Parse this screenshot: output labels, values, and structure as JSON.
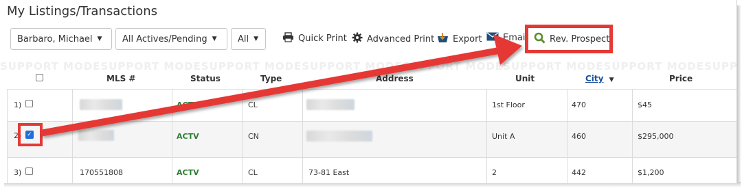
{
  "page": {
    "title": "My Listings/Transactions"
  },
  "filters": {
    "agent": "Barbaro, Michael",
    "status_filter": "All Actives/Pending",
    "scope": "All"
  },
  "toolbar": {
    "quick_print": "Quick Print",
    "advanced_print": "Advanced Print",
    "export": "Export",
    "email": "Email",
    "rev_prospect": "Rev. Prospect"
  },
  "watermark": "SUPPORT MODESUPPORT MODESUPPORT MODESUPPORT MODESUPPORT MODESUPPORT MODESUPPORT MODESUPPORT MODESUPPORT MODESUPPORT MODESUPPORT MODE",
  "table": {
    "headers": {
      "mls": "MLS #",
      "status": "Status",
      "type": "Type",
      "address": "Address",
      "unit": "Unit",
      "city": "City",
      "price": "Price"
    },
    "rows": [
      {
        "num": "1)",
        "checked": false,
        "status": "ACTV",
        "type": "CL",
        "unit": "1st Floor",
        "city": "470",
        "price": "$45"
      },
      {
        "num": "2)",
        "checked": true,
        "status": "ACTV",
        "type": "CN",
        "unit": "Unit A",
        "city": "460",
        "price": "$295,000"
      },
      {
        "num": "3)",
        "checked": false,
        "mls": "170551808",
        "status": "ACTV",
        "type": "CL",
        "address": "73-81 East",
        "unit": "2",
        "city": "442",
        "price": "$1,200"
      }
    ]
  },
  "colors": {
    "accent_red": "#e53935",
    "status_green": "#2e7d32",
    "link_blue": "#1a4fa0",
    "checkbox_blue": "#1e6fd9"
  }
}
